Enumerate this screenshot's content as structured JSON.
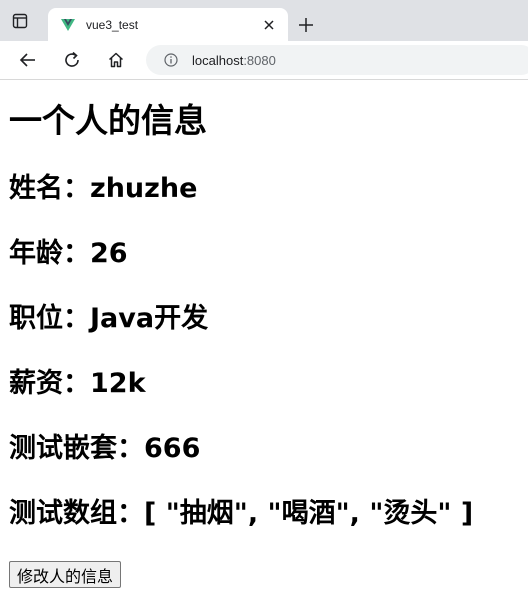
{
  "browser": {
    "tab_title": "vue3_test",
    "url_host": "localhost",
    "url_port": ":8080"
  },
  "content": {
    "heading": "一个人的信息",
    "name_line": "姓名：zhuzhe",
    "age_line": "年龄：26",
    "job_line": "职位：Java开发",
    "salary_line": "薪资：12k",
    "nested_line": "测试嵌套：666",
    "array_line": "测试数组：[ \"抽烟\", \"喝酒\", \"烫头\" ]",
    "button_label": "修改人的信息"
  },
  "colors": {
    "vue_green": "#41b883",
    "vue_dark": "#35495e"
  }
}
